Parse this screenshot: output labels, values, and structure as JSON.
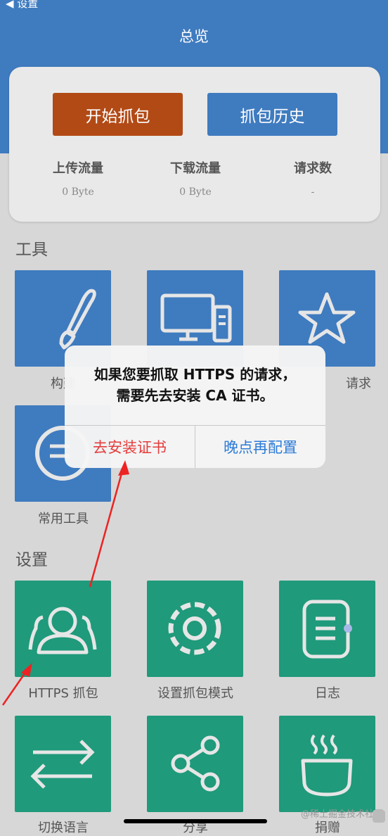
{
  "nav": {
    "back_label": "◀ 设置",
    "title": "总览"
  },
  "card": {
    "start_button": "开始抓包",
    "history_button": "抓包历史",
    "stats": [
      {
        "label": "上传流量",
        "value": "0 Byte"
      },
      {
        "label": "下载流量",
        "value": "0 Byte"
      },
      {
        "label": "请求数",
        "value": "-"
      }
    ]
  },
  "tools": {
    "heading": "工具",
    "items": [
      {
        "label": "构建",
        "icon": "brush-icon"
      },
      {
        "label": "",
        "icon": "desktop-icon"
      },
      {
        "label": "请求",
        "icon": "star-icon"
      },
      {
        "label": "常用工具",
        "icon": "tools-icon"
      }
    ]
  },
  "settings": {
    "heading": "设置",
    "items": [
      {
        "label": "HTTPS 抓包",
        "icon": "users-icon"
      },
      {
        "label": "设置抓包模式",
        "icon": "gear-icon"
      },
      {
        "label": "日志",
        "icon": "notebook-icon"
      },
      {
        "label": "切换语言",
        "icon": "swap-icon"
      },
      {
        "label": "分享",
        "icon": "share-icon"
      },
      {
        "label": "捐赠",
        "icon": "coffee-icon"
      }
    ]
  },
  "dialog": {
    "message_line1": "如果您要抓取 HTTPS 的请求，",
    "message_line2": "需要先去安装 CA 证书。",
    "install_button": "去安装证书",
    "later_button": "晚点再配置"
  },
  "watermark": "@稀土掘金技术社区",
  "colors": {
    "blue": "#3f7bbf",
    "green": "#1f9a7b",
    "start": "#b24a16",
    "danger": "#e53c3c",
    "link": "#2b7bd8"
  }
}
